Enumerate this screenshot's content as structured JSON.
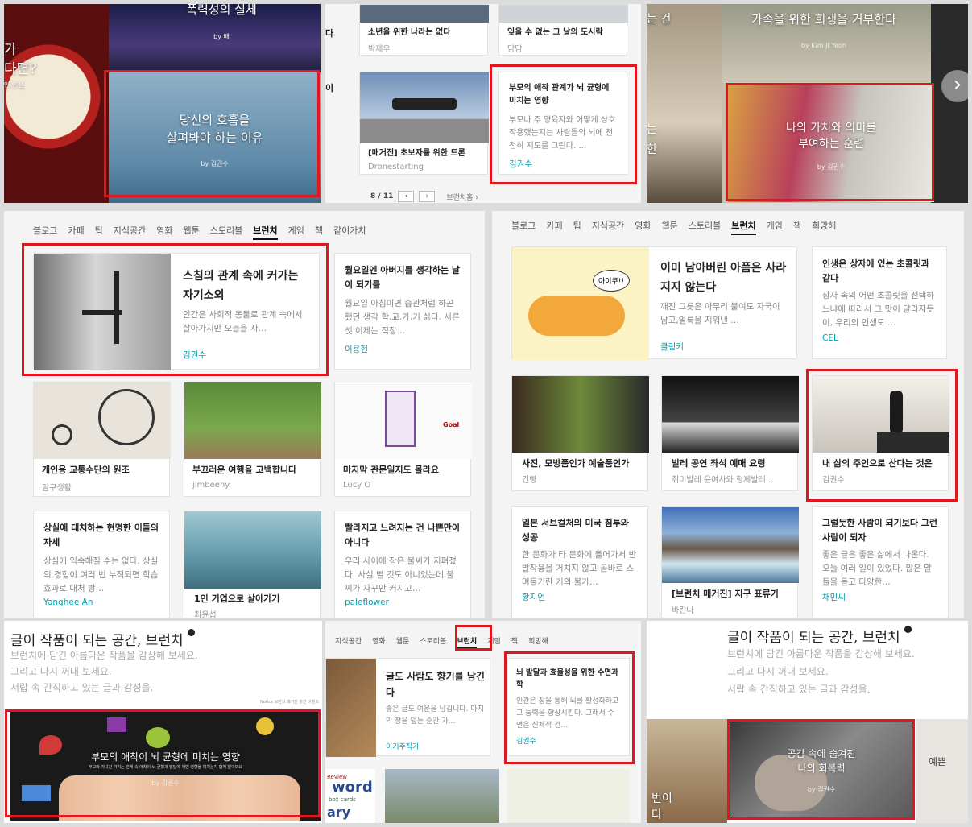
{
  "p1": {
    "top_title": "폭력성의 실체",
    "top_by": "by 배",
    "left_a": "가",
    "left_b": "다면?",
    "left_c": "인 인생",
    "feature": {
      "l1": "당신의 호흡을",
      "l2": "살펴봐야 하는 이유",
      "by": "by 김권수"
    }
  },
  "p2": {
    "c1t": "소년을 위한 나라는 없다",
    "c1a": "박재우",
    "c2t": "잊을 수 없는 그 날의 도시락",
    "c2a": "담담",
    "side_a": "다",
    "side_b": "이",
    "c3t": "[매거진] 초보자를 위한 드론",
    "c3a": "Dronestarting",
    "c4t": "부모의 애착 관계가 뇌 균형에 미치는 영향",
    "c4d": "부모나 주 양육자와 어떻게 상호작용했는지는 사람들의 뇌에 천천히 지도를 그린다. …",
    "c4a": "김권수",
    "page": "8 / 11",
    "more": "브런치홈 ›"
  },
  "p3": {
    "top_title": "가족을 위한 희생을 거부한다",
    "top_by": "by Kim Ji Yeon",
    "left_a": "는 건",
    "left_b": "는",
    "left_c": "한",
    "feature": {
      "l1": "나의 가치와 의미를",
      "l2": "부여하는 훈련",
      "by": "by 김권수"
    },
    "right": "›"
  },
  "p4": {
    "tabs": [
      "블로그",
      "카페",
      "팁",
      "지식공간",
      "영화",
      "웹툰",
      "스토리볼",
      "브런치",
      "게임",
      "책",
      "같이가치"
    ],
    "active": 7,
    "f": {
      "t": "스침의 관계 속에 커가는 자기소외",
      "d": "인간은 사회적 동물로 관계 속에서 살아가지만 오늘을 사…",
      "a": "김권수"
    },
    "s": {
      "t": "월요일엔 아버지를 생각하는 날이 되기를",
      "d": "월요일 아침이면 습관처럼 하곤 했던 생각 학.교.가.기 싫다. 서른셋 이제는 직장…",
      "a": "이용현"
    },
    "g1": [
      {
        "t": "개인용 교통수단의 원조",
        "a": "탐구생활"
      },
      {
        "t": "부끄러운 여행을 고백합니다",
        "a": "jimbeeny"
      },
      {
        "t": "마지막 관문일지도 몰라요",
        "a": "Lucy O"
      }
    ],
    "r1": {
      "t": "상실에 대처하는 현명한 이들의 자세",
      "d": "상실에 익숙해질 수는 없다. 상실의 경험이 여러 번 누적되면 학습 효과로 대처 방…",
      "a": "Yanghee An"
    },
    "r2": {
      "t": "1인 기업으로 살아가기",
      "a": "최윤섭"
    },
    "r3": {
      "t": "빨라지고 느려지는 건 나쁜만이 아니다",
      "d": "우리 사이에 작은 불씨가 지펴졌다. 사실 별 것도 아니었는데 불씨가 자꾸만 커지고…",
      "a": "paleflower"
    },
    "doodle": "Goal"
  },
  "p5": {
    "tabs": [
      "블로그",
      "카페",
      "팁",
      "지식공간",
      "영화",
      "웹툰",
      "스토리볼",
      "브런치",
      "게임",
      "책",
      "희망해"
    ],
    "active": 7,
    "f": {
      "t": "이미 남아버린 아픔은 사라지지 않는다",
      "d": "깨진 그릇은 아무리 붙여도 자국이 남고,얼룩을 지워낸 …",
      "a": "클링키",
      "bubble": "아이쿠!!"
    },
    "s": {
      "t": "인생은 상자에 있는 초콜릿과 같다",
      "d": "상자 속의 어떤 초콜릿을 선택하느냐에 따라서 그 맛이 달라지듯이, 우리의 인생도 …",
      "a": "CEL"
    },
    "g1": [
      {
        "t": "사진, 모방품인가 예술품인가",
        "a": "건빵"
      },
      {
        "t": "발레 공연 좌석 예매 요령",
        "a": "취미발레 윤여사와 형제발레…"
      },
      {
        "t": "내 삶의 주인으로 산다는 것은",
        "a": "김권수"
      }
    ],
    "r1": {
      "t": "일본 서브컬처의 미국 침투와 성공",
      "d": "한 문화가 타 문화에 들어가서 반발작용을 거치지 않고 곧바로 스며들기란 거의 불가…",
      "a": "황지언"
    },
    "r2": {
      "t": "[브런치 매거진] 지구 표류기",
      "a": "바칸나"
    },
    "r3": {
      "t": "그럴듯한 사람이 되기보다 그런 사람이 되자",
      "d": "좋은 글은 좋은 삶에서 나온다. 오늘 여러 일이 있었다. 많은 말들을 듣고 다양한…",
      "a": "채민씨"
    }
  },
  "p6": {
    "title": "글이 작품이 되는 공간, 브런치",
    "l1": "브런치에 담긴 아름다운 작품을 감상해 보세요.",
    "l2": "그리고 다시 꺼내 보세요.",
    "l3": "서랍 속 간직하고 있는 글과 감성을.",
    "note": "Notice 브런치 매거진 창간 이벤트",
    "feature": {
      "l1": "부모의 애착이 뇌 균형에 미치는 영향",
      "sub": "부모와 자녀간 가지는 관계 속 애착이 뇌 균형과 발달에 어떤 영향을 미치는지 함께 알아봐요",
      "by": "by 김권수"
    }
  },
  "p7": {
    "tabs": [
      "지식공간",
      "영화",
      "웹툰",
      "스토리볼",
      "브런치",
      "게임",
      "책",
      "희망해"
    ],
    "active": 4,
    "c1": {
      "t": "글도 사람도 향기를 남긴다",
      "d": "좋은 글도 여운을 남깁니다. 마지막 장을 덮는 순간 가…",
      "a": "이기주작가"
    },
    "c2": {
      "t": "뇌 발달과 효율성을 위한 수면과학",
      "d": "인간은 잠을 통해 뇌를 활성화하고 그 능력을 향상시킨다. 그래서 수면은 신체적 건…",
      "a": "김권수"
    },
    "words": {
      "w1": "Review",
      "w2": "word",
      "w3": "box cards",
      "w4": "ary"
    }
  },
  "p8": {
    "title": "글이 작품이 되는 공간, 브런치",
    "l1": "브런치에 담긴 아름다운 작품을 감상해 보세요.",
    "l2": "그리고 다시 꺼내 보세요.",
    "l3": "서랍 속 간직하고 있는 글과 감성을.",
    "feature": {
      "l1": "공감 속에 숨겨진",
      "l2": "나의 회복력",
      "by": "by 김권수"
    },
    "left_a": "번이",
    "left_b": "다",
    "right": "예쁜"
  },
  "colors": {
    "accent": "#e0171e",
    "author": "#00a0b0"
  }
}
